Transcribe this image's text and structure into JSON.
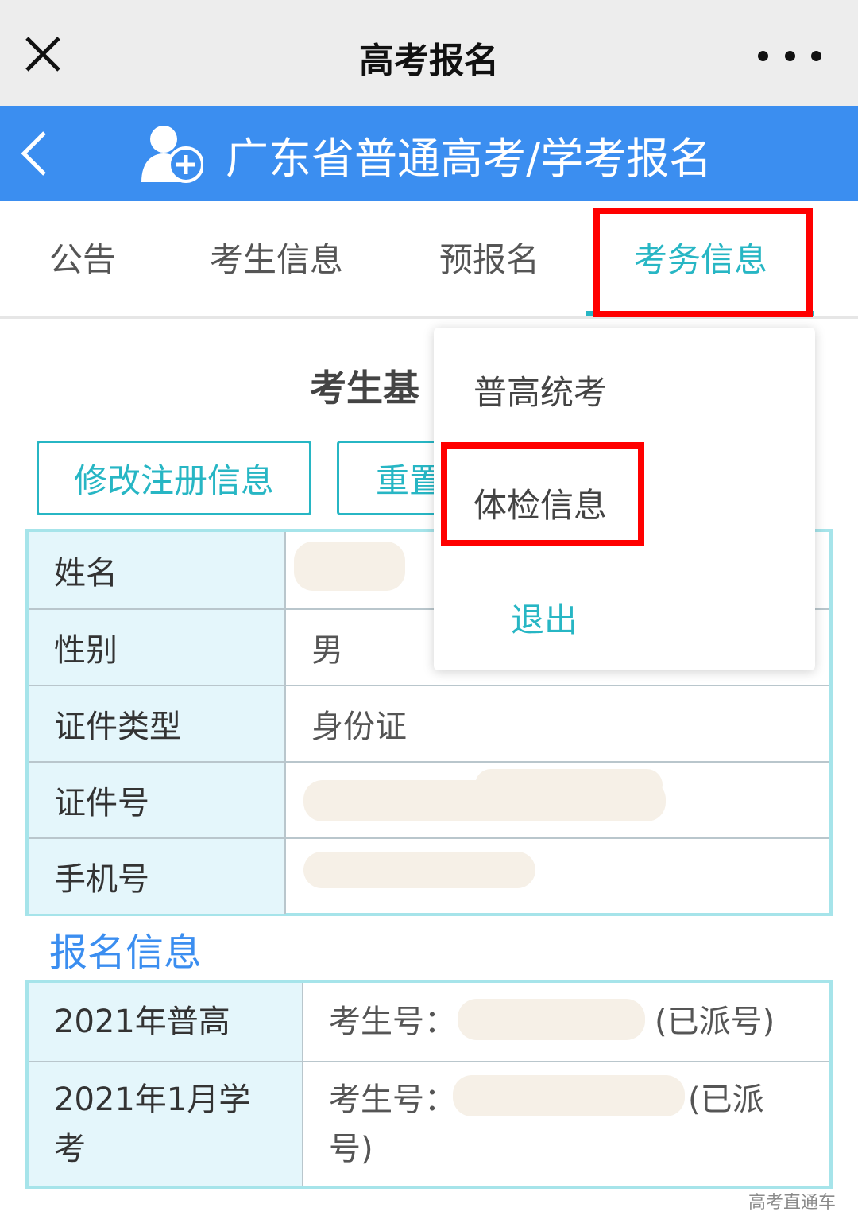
{
  "window": {
    "title": "高考报名"
  },
  "header": {
    "title": "广东省普通高考/学考报名",
    "color": "#3b8ef0"
  },
  "tabs": [
    {
      "label": "公告"
    },
    {
      "label": "考生信息"
    },
    {
      "label": "预报名"
    },
    {
      "label": "考务信息",
      "active": true
    }
  ],
  "section": {
    "title_visible": "考生基"
  },
  "buttons": {
    "edit_label": "修改注册信息",
    "reset_label_visible": "重置"
  },
  "basic_info": {
    "rows": [
      {
        "label": "姓名",
        "value": ""
      },
      {
        "label": "性别",
        "value": "男"
      },
      {
        "label": "证件类型",
        "value": "身份证"
      },
      {
        "label": "证件号",
        "value": ""
      },
      {
        "label": "手机号",
        "value": ""
      }
    ]
  },
  "registration": {
    "title": "报名信息",
    "rows": [
      {
        "label": "2021年普高",
        "value_prefix": "考生号：",
        "value_suffix": "(已派号)"
      },
      {
        "label_line1": "2021年1月学",
        "label_line2": "考",
        "value_prefix": "考生号：",
        "value_suffix_line1": "(已派",
        "value_suffix_line2": "号)"
      }
    ]
  },
  "dropdown": {
    "items": [
      {
        "label": "普高统考"
      },
      {
        "label": "体检信息",
        "highlighted": true
      },
      {
        "label": "退出"
      }
    ]
  },
  "watermark": "高考直通车",
  "colors": {
    "accent": "#27b6c4",
    "highlight_box": "#ff0000",
    "table_border": "#a6e4ea",
    "label_bg": "#e4f6fb"
  },
  "icons": {
    "close": "close-icon",
    "more": "more-icon",
    "back": "chevron-left-icon",
    "user_add": "user-add-icon"
  }
}
